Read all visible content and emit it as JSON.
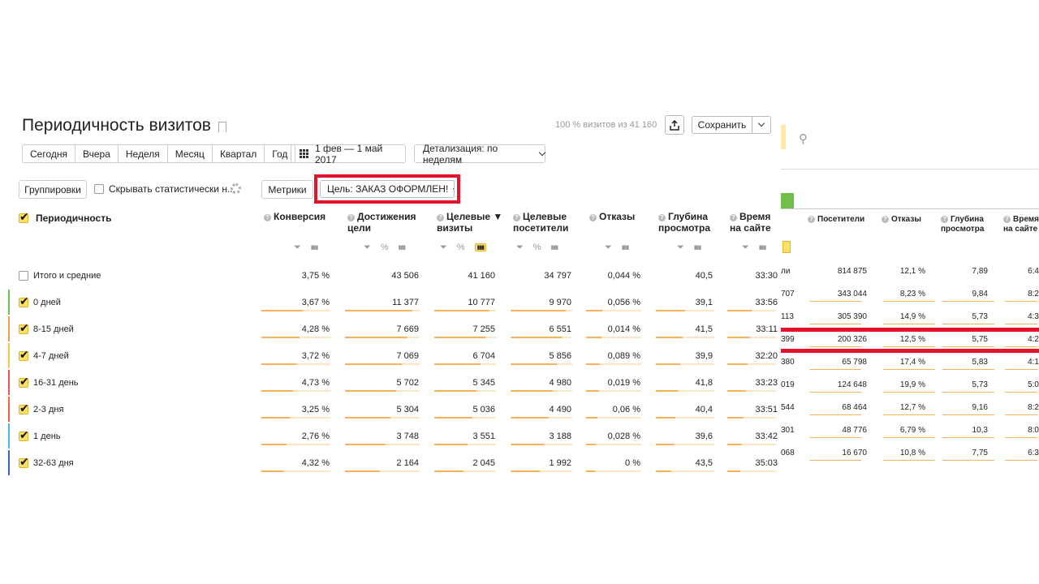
{
  "header": {
    "title": "Периодичность визитов",
    "visits_info": "100 % визитов из 41 160",
    "save_label": "Сохранить"
  },
  "periods": [
    "Сегодня",
    "Вчера",
    "Неделя",
    "Месяц",
    "Квартал",
    "Год"
  ],
  "date_range": "1 фев — 1 май 2017",
  "detail": "Детализация: по неделям",
  "toolbar": {
    "groupings": "Группировки",
    "hide_stat": "Скрывать статистически н...",
    "metrics": "Метрики",
    "goal": "Цель: ЗАКАЗ ОФОРМЛЕН!"
  },
  "table": {
    "dimension_header": "Периодичность",
    "columns": [
      {
        "line1": "Конверсия",
        "line2": ""
      },
      {
        "line1": "Достижения",
        "line2": "цели"
      },
      {
        "line1": "Целевые ▼",
        "line2": "визиты"
      },
      {
        "line1": "Целевые",
        "line2": "посетители"
      },
      {
        "line1": "Отказы",
        "line2": ""
      },
      {
        "line1": "Глубина",
        "line2": "просмотра"
      },
      {
        "line1": "Время",
        "line2": "на сайте"
      }
    ],
    "total_label": "Итого и средние",
    "totals": [
      "3,75 %",
      "43 506",
      "41 160",
      "34 797",
      "0,044 %",
      "40,5",
      "33:30"
    ],
    "rows": [
      {
        "label": "0 дней",
        "color": "#6fbf4a",
        "values": [
          "3,67 %",
          "11 377",
          "10 777",
          "9 970",
          "0,056 %",
          "39,1",
          "33:56"
        ]
      },
      {
        "label": "8-15 дней",
        "color": "#f0a04a",
        "values": [
          "4,28 %",
          "7 669",
          "7 255",
          "6 551",
          "0,014 %",
          "41,5",
          "33:11"
        ]
      },
      {
        "label": "4-7 дней",
        "color": "#f7c64a",
        "values": [
          "3,72 %",
          "7 069",
          "6 704",
          "5 856",
          "0,089 %",
          "39,9",
          "32:20"
        ]
      },
      {
        "label": "16-31 день",
        "color": "#e35a5a",
        "values": [
          "4,73 %",
          "5 702",
          "5 345",
          "4 980",
          "0,019 %",
          "41,8",
          "33:23"
        ]
      },
      {
        "label": "2-3 дня",
        "color": "#e8683a",
        "values": [
          "3,25 %",
          "5 304",
          "5 036",
          "4 490",
          "0,06 %",
          "40,4",
          "33:51"
        ]
      },
      {
        "label": "1 день",
        "color": "#4ab0e8",
        "values": [
          "2,76 %",
          "3 748",
          "3 551",
          "3 188",
          "0,028 %",
          "39,6",
          "33:42"
        ]
      },
      {
        "label": "32-63 дня",
        "color": "#3a6abf",
        "values": [
          "4,32 %",
          "2 164",
          "2 045",
          "1 992",
          "0 %",
          "43,5",
          "35:03"
        ]
      }
    ]
  },
  "right_panel": {
    "columns": [
      {
        "line1": "Посетители",
        "line2": ""
      },
      {
        "line1": "Отказы",
        "line2": ""
      },
      {
        "line1": "Глубина",
        "line2": "просмотра"
      },
      {
        "line1": "Время",
        "line2": "на сайте"
      }
    ],
    "partial_left": [
      "ли",
      "707",
      "113",
      "399",
      "380",
      "019",
      "544",
      "301",
      "068"
    ],
    "rows": [
      [
        "814 875",
        "12,1 %",
        "7,89",
        "6:4"
      ],
      [
        "343 044",
        "8,23 %",
        "9,84",
        "8:2"
      ],
      [
        "305 390",
        "14,9 %",
        "5,73",
        "4:3"
      ],
      [
        "200 326",
        "12,5 %",
        "5,75",
        "4:2"
      ],
      [
        "65 798",
        "17,4 %",
        "5,83",
        "4:1"
      ],
      [
        "124 648",
        "19,9 %",
        "5,73",
        "5:0"
      ],
      [
        "68 464",
        "12,7 %",
        "9,16",
        "8:2"
      ],
      [
        "48 776",
        "6,79 %",
        "10,3",
        "8:0"
      ],
      [
        "16 670",
        "10,8 %",
        "7,75",
        "6:3"
      ]
    ]
  }
}
